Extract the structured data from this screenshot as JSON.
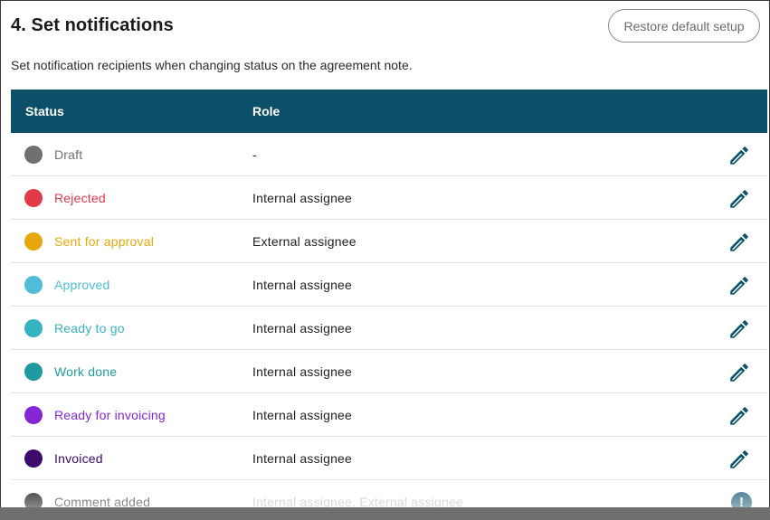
{
  "section": {
    "title": "4. Set notifications",
    "restore_label": "Restore default setup",
    "description": "Set notification recipients when changing status on the agreement note."
  },
  "table": {
    "columns": {
      "status": "Status",
      "role": "Role"
    },
    "rows": [
      {
        "status": "Draft",
        "color": "#707070",
        "role": "-",
        "action": "pencil-icon"
      },
      {
        "status": "Rejected",
        "color": "#e03a48",
        "role": "Internal assignee",
        "action": "pencil-icon"
      },
      {
        "status": "Sent for approval",
        "color": "#e6a80c",
        "role": "External assignee",
        "action": "pencil-icon"
      },
      {
        "status": "Approved",
        "color": "#4fbcd8",
        "role": "Internal assignee",
        "action": "pencil-icon"
      },
      {
        "status": "Ready to go",
        "color": "#36b3c2",
        "role": "Internal assignee",
        "action": "pencil-icon"
      },
      {
        "status": "Work done",
        "color": "#1f9aa0",
        "role": "Internal assignee",
        "action": "pencil-icon"
      },
      {
        "status": "Ready for invoicing",
        "color": "#8426d3",
        "role": "Internal assignee",
        "action": "pencil-icon"
      },
      {
        "status": "Invoiced",
        "color": "#3b0a6b",
        "role": "Internal assignee",
        "action": "pencil-icon"
      },
      {
        "status": "Comment added",
        "color": "#000000",
        "role": "Internal assignee, External assignee",
        "action": "exclamation-icon",
        "action_glyph": "!"
      }
    ]
  },
  "colors": {
    "header_bg": "#0b5068",
    "icon": "#0b5068"
  }
}
